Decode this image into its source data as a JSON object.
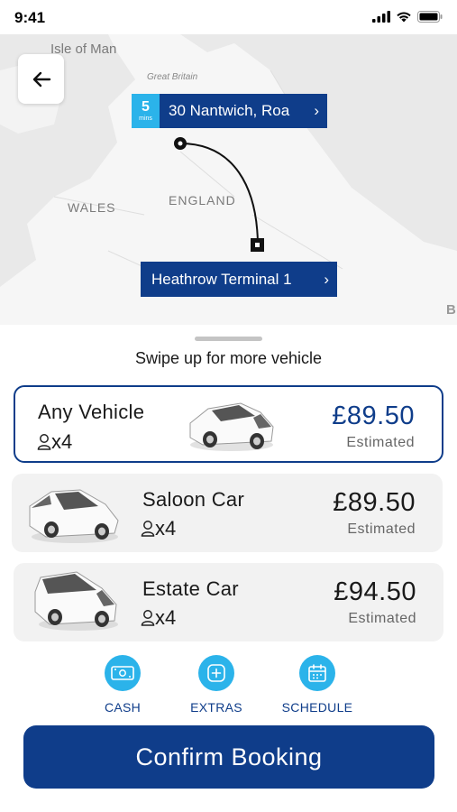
{
  "status_bar": {
    "time": "9:41"
  },
  "map": {
    "labels": {
      "isle_of_man": "Isle of Man",
      "great_britain": "Great Britain",
      "wales": "WALES",
      "england": "ENGLAND",
      "edge_letter": "B"
    },
    "pickup": {
      "eta_value": "5",
      "eta_unit": "mins",
      "address": "30 Nantwich, Roa",
      "chevron": "›"
    },
    "dropoff": {
      "address": "Heathrow Terminal 1",
      "chevron": "›"
    }
  },
  "sheet": {
    "hint": "Swipe up for more vehicle",
    "vehicles": [
      {
        "name": "Any Vehicle",
        "passengers": "x4",
        "price": "£89.50",
        "price_note": "Estimated",
        "selected": true
      },
      {
        "name": "Saloon Car",
        "passengers": "x4",
        "price": "£89.50",
        "price_note": "Estimated",
        "selected": false
      },
      {
        "name": "Estate Car",
        "passengers": "x4",
        "price": "£94.50",
        "price_note": "Estimated",
        "selected": false
      }
    ],
    "options": [
      {
        "label": "CASH",
        "icon": "cash-icon"
      },
      {
        "label": "EXTRAS",
        "icon": "plus-icon"
      },
      {
        "label": "SCHEDULE",
        "icon": "calendar-icon"
      }
    ],
    "confirm_label": "Confirm Booking"
  },
  "colors": {
    "brand_navy": "#0f3d8a",
    "accent_cyan": "#2bb3ea",
    "card_grey": "#f2f2f2"
  }
}
